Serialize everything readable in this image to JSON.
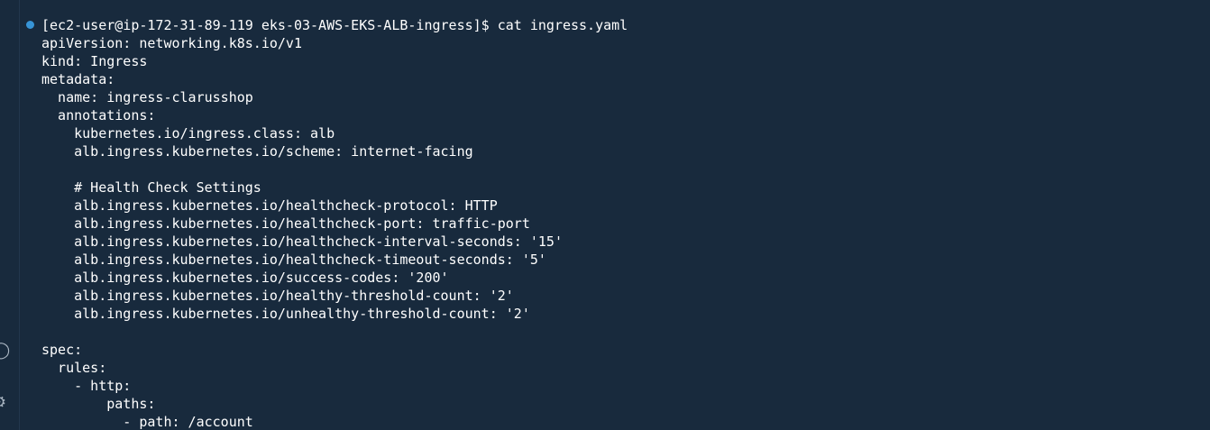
{
  "terminal": {
    "prompt": "[ec2-user@ip-172-31-89-119 eks-03-AWS-EKS-ALB-ingress]$ cat ingress.yaml",
    "output_lines": [
      "apiVersion: networking.k8s.io/v1",
      "kind: Ingress",
      "metadata:",
      "  name: ingress-clarusshop",
      "  annotations:",
      "    kubernetes.io/ingress.class: alb",
      "    alb.ingress.kubernetes.io/scheme: internet-facing",
      "",
      "    # Health Check Settings",
      "    alb.ingress.kubernetes.io/healthcheck-protocol: HTTP",
      "    alb.ingress.kubernetes.io/healthcheck-port: traffic-port",
      "    alb.ingress.kubernetes.io/healthcheck-interval-seconds: '15'",
      "    alb.ingress.kubernetes.io/healthcheck-timeout-seconds: '5'",
      "    alb.ingress.kubernetes.io/success-codes: '200'",
      "    alb.ingress.kubernetes.io/healthy-threshold-count: '2'",
      "    alb.ingress.kubernetes.io/unhealthy-threshold-count: '2'",
      "",
      "spec:",
      "  rules:",
      "    - http:",
      "        paths:",
      "          - path: /account"
    ]
  },
  "gutter": {
    "icons": [
      "account-icon",
      "settings-gear-icon"
    ]
  },
  "colors": {
    "background": "#182a3d",
    "text": "#ffffff",
    "prompt_dot": "#3794d6"
  }
}
